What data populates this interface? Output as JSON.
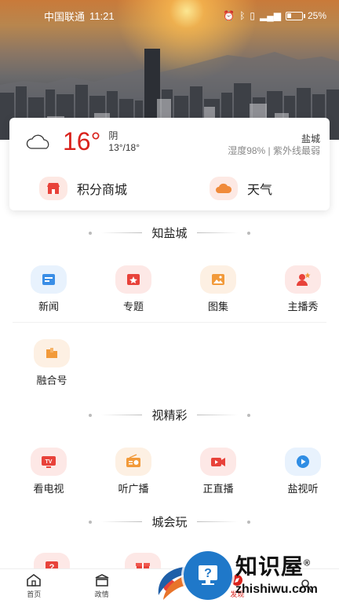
{
  "status": {
    "carrier": "中国联通",
    "time": "11:21",
    "battery": "25%"
  },
  "weather": {
    "temp": "16°",
    "condition": "阴",
    "range": "13°/18°",
    "city": "盐城",
    "details": "湿度98% | 紫外线最弱"
  },
  "card_links": [
    {
      "label": "积分商城",
      "icon": "shop-icon"
    },
    {
      "label": "天气",
      "icon": "weather-icon"
    }
  ],
  "sections": [
    {
      "title": "知盐城",
      "items": [
        {
          "label": "新闻",
          "icon": "news-icon",
          "color": "#3a8ee6",
          "bg": "#e8f2fd"
        },
        {
          "label": "专题",
          "icon": "topic-icon",
          "color": "#e8423a",
          "bg": "#fde8e6"
        },
        {
          "label": "图集",
          "icon": "gallery-icon",
          "color": "#f29a3a",
          "bg": "#fdf0e3"
        },
        {
          "label": "主播秀",
          "icon": "anchor-icon",
          "color": "#e8423a",
          "bg": "#fde8e6"
        },
        {
          "label": "融合号",
          "icon": "media-icon",
          "color": "#f29a3a",
          "bg": "#fdf0e3"
        }
      ]
    },
    {
      "title": "视精彩",
      "items": [
        {
          "label": "看电视",
          "icon": "tv-icon",
          "color": "#e8423a",
          "bg": "#fde8e6"
        },
        {
          "label": "听广播",
          "icon": "radio-icon",
          "color": "#f29a3a",
          "bg": "#fdf0e3"
        },
        {
          "label": "正直播",
          "icon": "live-icon",
          "color": "#e8423a",
          "bg": "#fde8e6"
        },
        {
          "label": "盐视听",
          "icon": "play-icon",
          "color": "#2f8de4",
          "bg": "#e8f2fd"
        }
      ]
    },
    {
      "title": "城会玩",
      "items": [
        {
          "label": "",
          "icon": "question-icon",
          "color": "#e8423a",
          "bg": "#fde8e6"
        },
        {
          "label": "",
          "icon": "gift-icon",
          "color": "#e8423a",
          "bg": "#fde8e6"
        }
      ]
    }
  ],
  "tabs": [
    {
      "label": "首页",
      "icon": "home-icon"
    },
    {
      "label": "政情",
      "icon": "government-icon"
    },
    {
      "label": "",
      "icon": "center-icon"
    },
    {
      "label": "发现",
      "icon": "discover-icon"
    },
    {
      "label": "",
      "icon": "mine-icon"
    }
  ],
  "watermark": {
    "cn": "知识屋",
    "en": "zhishiwu.com",
    "mark": "®"
  }
}
